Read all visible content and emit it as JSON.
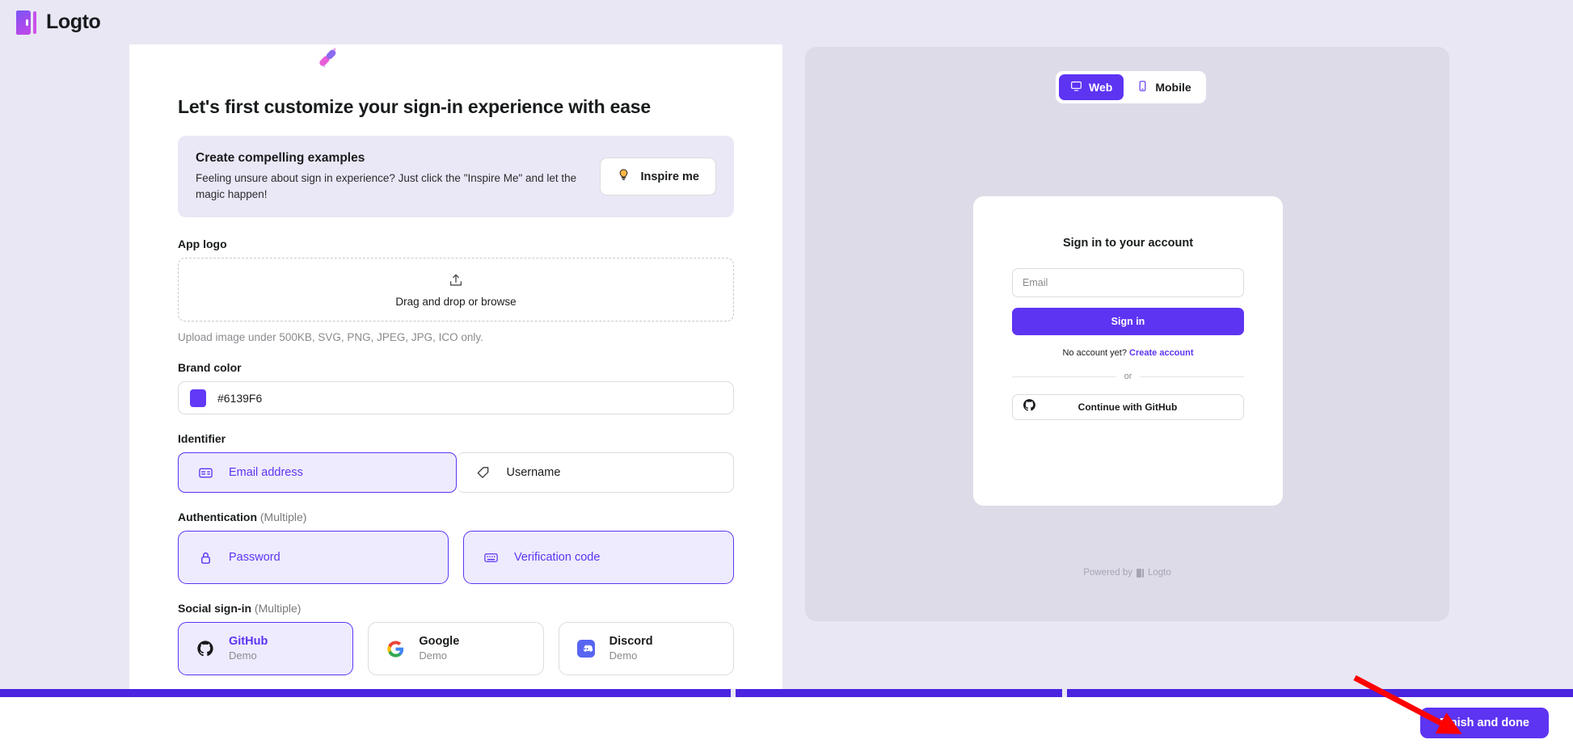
{
  "header": {
    "brand": "Logto",
    "logo_icon": "logto-logo-icon",
    "bg_color": "#e9e7f4"
  },
  "form": {
    "decor_emoji": "✨",
    "title": "Let's first customize your sign-in experience with ease",
    "inspire": {
      "title": "Create compelling examples",
      "description": "Feeling unsure about sign in experience? Just click the \"Inspire Me\" and let the magic happen!",
      "button_label": "Inspire me",
      "button_icon": "lightbulb-icon"
    },
    "app_logo": {
      "label": "App logo",
      "upload_icon": "upload-tray-icon",
      "drop_hint": "Drag and drop or browse",
      "note": "Upload image under 500KB, SVG, PNG, JPEG, JPG, ICO only."
    },
    "brand_color": {
      "label": "Brand color",
      "value": "#6139F6",
      "swatch_color": "#6139F6"
    },
    "identifier": {
      "label": "Identifier",
      "options": [
        {
          "label": "Email address",
          "icon": "email-card-icon",
          "selected": true
        },
        {
          "label": "Username",
          "icon": "tag-icon",
          "selected": false
        }
      ]
    },
    "authentication": {
      "label": "Authentication",
      "label_suffix": "(Multiple)",
      "options": [
        {
          "label": "Password",
          "icon": "lock-icon",
          "selected": true
        },
        {
          "label": "Verification code",
          "icon": "keypad-icon",
          "selected": true
        }
      ]
    },
    "social_signin": {
      "label": "Social sign-in",
      "label_suffix": "(Multiple)",
      "options": [
        {
          "name": "GitHub",
          "subtitle": "Demo",
          "icon": "github-icon",
          "selected": true
        },
        {
          "name": "Google",
          "subtitle": "Demo",
          "icon": "google-icon",
          "selected": false
        },
        {
          "name": "Discord",
          "subtitle": "Demo",
          "icon": "discord-icon",
          "selected": false
        }
      ]
    }
  },
  "preview": {
    "device_tabs": [
      {
        "label": "Web",
        "icon": "monitor-icon",
        "active": true
      },
      {
        "label": "Mobile",
        "icon": "phone-icon",
        "active": false
      }
    ],
    "card": {
      "title": "Sign in to your account",
      "email_placeholder": "Email",
      "email_value": "",
      "submit_label": "Sign in",
      "signup_prompt": "No account yet?",
      "signup_link": "Create account",
      "divider_label": "or",
      "social_button_label": "Continue with GitHub",
      "social_button_icon": "github-icon"
    },
    "powered_by": "Powered by",
    "powered_by_brand": "Logto"
  },
  "footer": {
    "finish_label": "Finish and done",
    "accent_color": "#5d34f2"
  },
  "progress": {
    "color": "#4b24e0",
    "segments": 3,
    "complete": true
  },
  "annotation": {
    "arrow_color": "#ff0000",
    "points_to": "finish-and-done-button"
  }
}
